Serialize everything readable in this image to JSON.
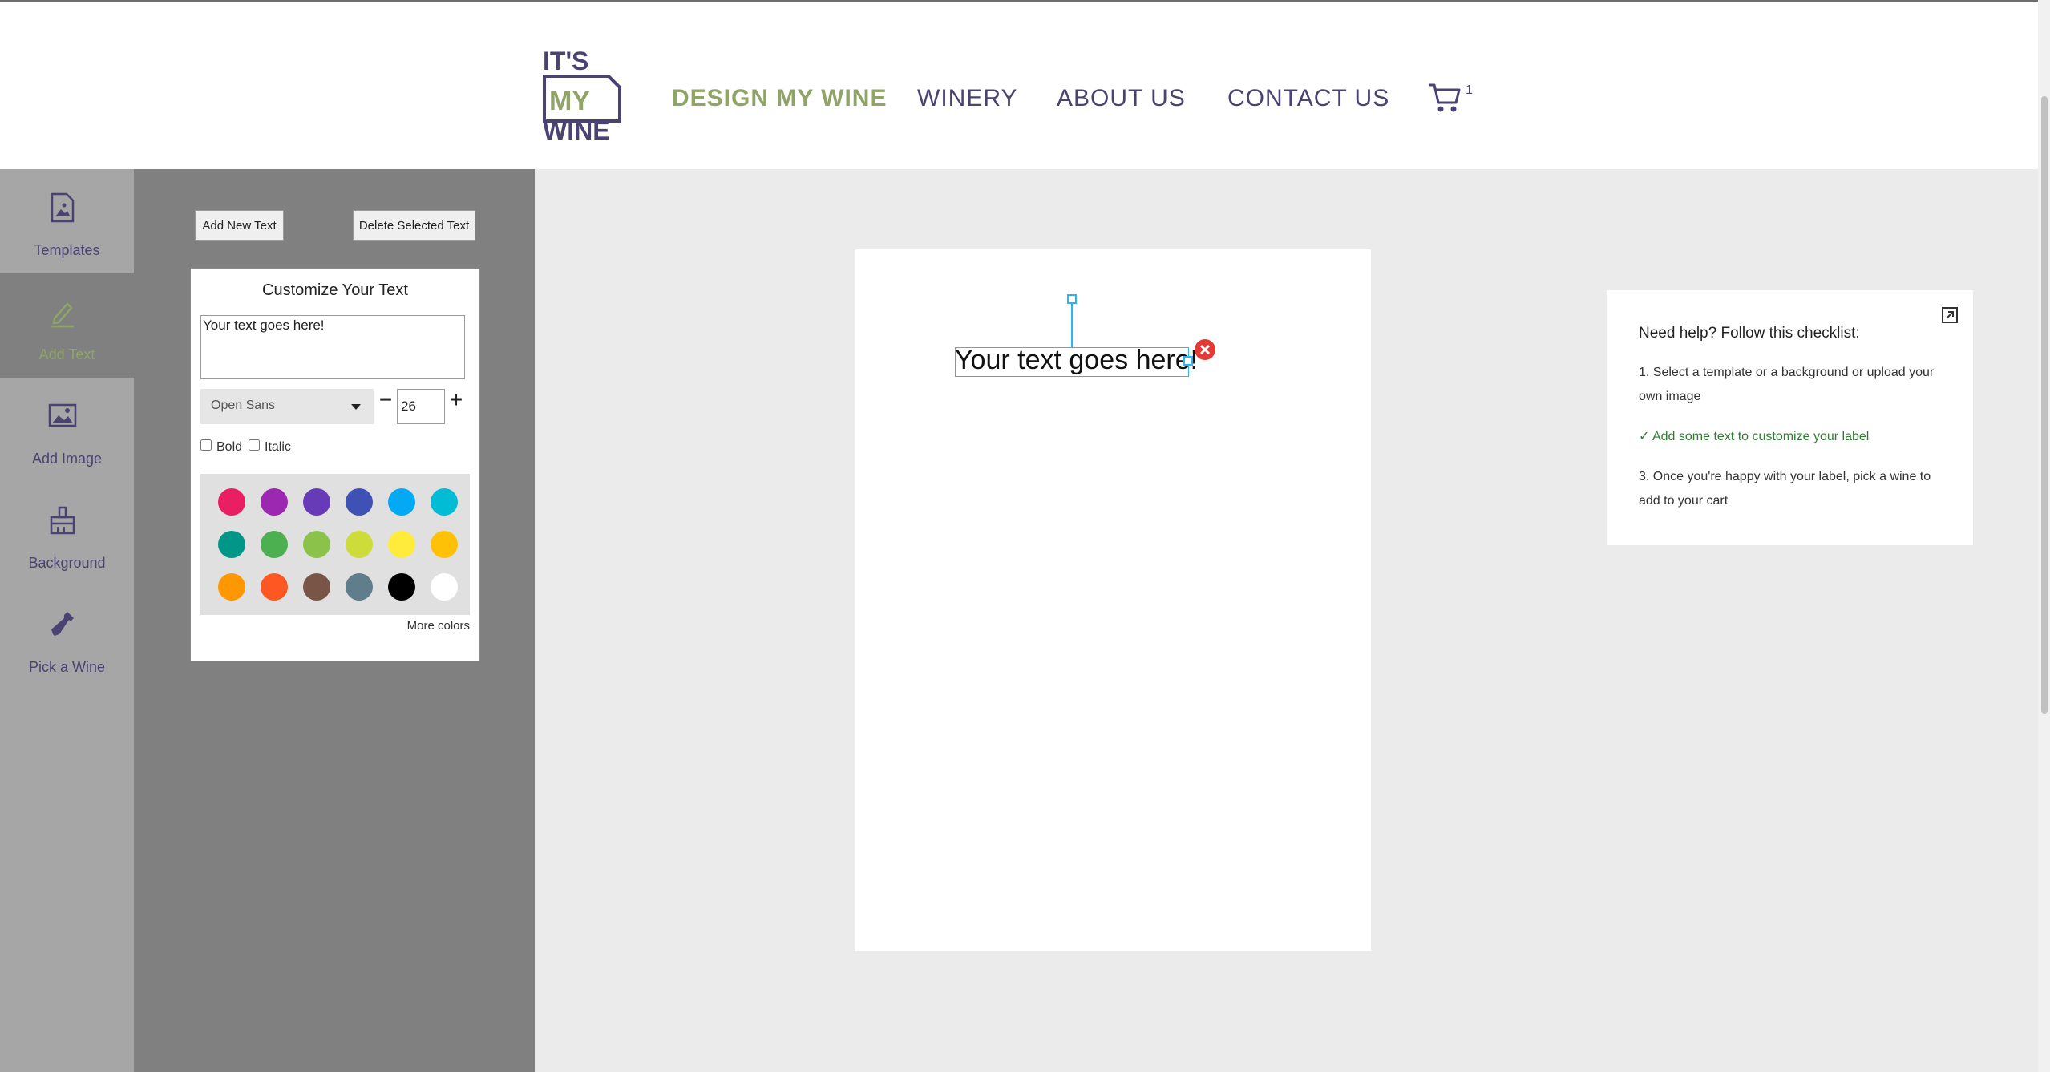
{
  "logo": {
    "line1": "IT'S",
    "line2": "MY",
    "line3": "WINE"
  },
  "nav": [
    {
      "label": "DESIGN MY WINE"
    },
    {
      "label": "WINERY"
    },
    {
      "label": "ABOUT US"
    },
    {
      "label": "CONTACT US"
    }
  ],
  "cart": {
    "count": "1",
    "icon": "cart-icon"
  },
  "rail": [
    {
      "label": "Templates",
      "icon": "template-icon"
    },
    {
      "label": "Add Text",
      "icon": "pencil-icon"
    },
    {
      "label": "Add Image",
      "icon": "image-icon"
    },
    {
      "label": "Background",
      "icon": "paint-brush-icon"
    },
    {
      "label": "Pick a Wine",
      "icon": "wine-bottle-icon"
    }
  ],
  "panel": {
    "add_button": "Add New Text",
    "delete_button": "Delete Selected Text",
    "card_title": "Customize Your Text",
    "text_value": "Your text goes here!",
    "font": "Open Sans",
    "size": "26",
    "bold": "Bold",
    "italic": "Italic",
    "more_colors": "More colors",
    "colors": [
      "#e91e63",
      "#9c27b0",
      "#673ab7",
      "#3f51b5",
      "#03a9f4",
      "#00bcd4",
      "#009688",
      "#4caf50",
      "#8bc34a",
      "#cddc39",
      "#ffeb3b",
      "#ffc107",
      "#ff9800",
      "#ff5722",
      "#795548",
      "#607d8b",
      "#000000",
      "#ffffff"
    ]
  },
  "canvas": {
    "text": "Your text goes here!"
  },
  "help": {
    "title": "Need help? Follow this checklist:",
    "step1": "1. Select a template or a background or upload your own image",
    "step2": "Add some text to customize your label",
    "step3": "3. Once you're happy with your label, pick a wine to add to your cart"
  },
  "colors": {
    "brand": "#4a4372",
    "accent": "#8fa466"
  }
}
